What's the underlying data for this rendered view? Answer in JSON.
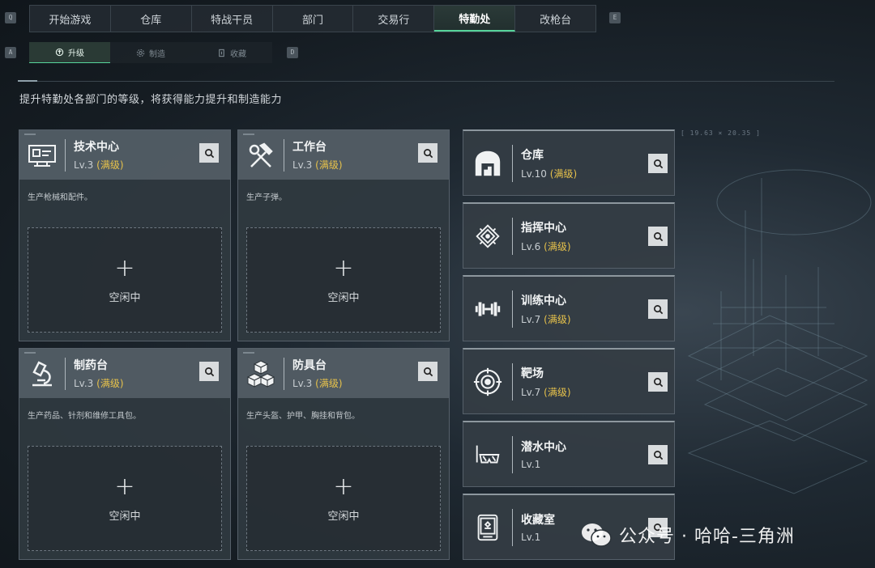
{
  "key_hints": {
    "left_top": "Q",
    "right_top": "E",
    "left_sub": "A",
    "right_sub": "D"
  },
  "top_tabs": [
    {
      "label": "开始游戏",
      "active": false
    },
    {
      "label": "仓库",
      "active": false
    },
    {
      "label": "特战干员",
      "active": false
    },
    {
      "label": "部门",
      "active": false
    },
    {
      "label": "交易行",
      "active": false
    },
    {
      "label": "特勤处",
      "active": true
    },
    {
      "label": "改枪台",
      "active": false
    }
  ],
  "sub_tabs": [
    {
      "label": "升级",
      "icon": "upgrade-icon",
      "active": true
    },
    {
      "label": "制造",
      "icon": "gear-icon",
      "active": false
    },
    {
      "label": "收藏",
      "icon": "collection-icon",
      "active": false
    }
  ],
  "page_description": "提升特勤处各部门的等级，将获得能力提升和制造能力",
  "coords_readout": "[ 19.63 × 20.35 ]",
  "max_label": "(满级)",
  "production_cards": [
    {
      "name": "技术中心",
      "level": "Lv.3",
      "max": true,
      "desc": "生产枪械和配件。",
      "icon": "monitor-icon",
      "slot_label": "空闲中"
    },
    {
      "name": "工作台",
      "level": "Lv.3",
      "max": true,
      "desc": "生产子弹。",
      "icon": "hammer-wrench-icon",
      "slot_label": "空闲中"
    },
    {
      "name": "制药台",
      "level": "Lv.3",
      "max": true,
      "desc": "生产药品、针剂和维修工具包。",
      "icon": "microscope-icon",
      "slot_label": "空闲中"
    },
    {
      "name": "防具台",
      "level": "Lv.3",
      "max": true,
      "desc": "生产头盔、护甲、胸挂和背包。",
      "icon": "cubes-icon",
      "slot_label": "空闲中"
    }
  ],
  "side_cards": [
    {
      "name": "仓库",
      "level": "Lv.10",
      "max": true,
      "icon": "warehouse-icon"
    },
    {
      "name": "指挥中心",
      "level": "Lv.6",
      "max": true,
      "icon": "chip-icon"
    },
    {
      "name": "训练中心",
      "level": "Lv.7",
      "max": true,
      "icon": "dumbbell-icon"
    },
    {
      "name": "靶场",
      "level": "Lv.7",
      "max": true,
      "icon": "target-icon"
    },
    {
      "name": "潜水中心",
      "level": "Lv.1",
      "max": false,
      "icon": "diving-mask-icon"
    },
    {
      "name": "收藏室",
      "level": "Lv.1",
      "max": false,
      "icon": "display-case-icon"
    }
  ],
  "watermark": "公众号 · 哈哈-三角洲",
  "colors": {
    "accent": "#56d49b",
    "max_level": "#e7c24b"
  }
}
